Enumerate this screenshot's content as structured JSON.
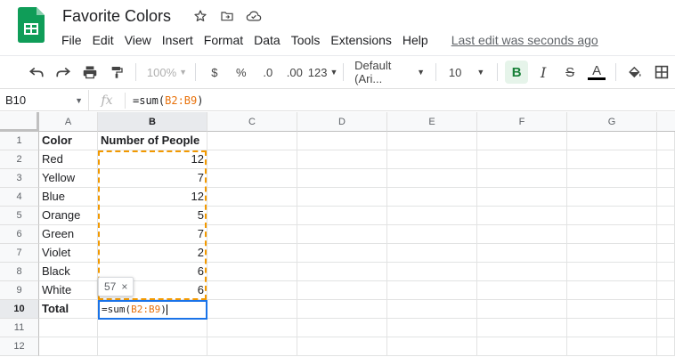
{
  "app": {
    "title": "Favorite Colors",
    "menus": [
      "File",
      "Edit",
      "View",
      "Insert",
      "Format",
      "Data",
      "Tools",
      "Extensions",
      "Help"
    ],
    "last_edit": "Last edit was seconds ago"
  },
  "toolbar": {
    "zoom": "100%",
    "currency": "$",
    "percent": "%",
    "dec_decrease": ".0",
    "dec_increase": ".00",
    "more_formats": "123",
    "font": "Default (Ari...",
    "font_size": "10",
    "bold": "B",
    "italic": "I",
    "strike": "S",
    "text_color": "A"
  },
  "formula_bar": {
    "name_box": "B10",
    "fx": "fx",
    "prefix": "=sum(",
    "range": "B2:B9",
    "suffix": ")"
  },
  "columns": [
    "A",
    "B",
    "C",
    "D",
    "E",
    "F",
    "G"
  ],
  "rows": [
    "1",
    "2",
    "3",
    "4",
    "5",
    "6",
    "7",
    "8",
    "9",
    "10",
    "11",
    "12"
  ],
  "cells": {
    "a1": "Color",
    "b1": "Number of People",
    "a2": "Red",
    "b2": "12",
    "a3": "Yellow",
    "b3": "7",
    "a4": "Blue",
    "b4": "12",
    "a5": "Orange",
    "b5": "5",
    "a6": "Green",
    "b6": "7",
    "a7": "Violet",
    "b7": "2",
    "a8": "Black",
    "b8": "6",
    "a9": "White",
    "b9": "6",
    "a10": "Total"
  },
  "editor": {
    "prefix": "=sum(",
    "range": "B2:B9",
    "suffix": ")"
  },
  "tooltip": {
    "value": "57",
    "close": "×"
  },
  "colors": {
    "accent": "#1a73e8",
    "range": "#f29900",
    "sheets_green": "#0f9d58"
  }
}
